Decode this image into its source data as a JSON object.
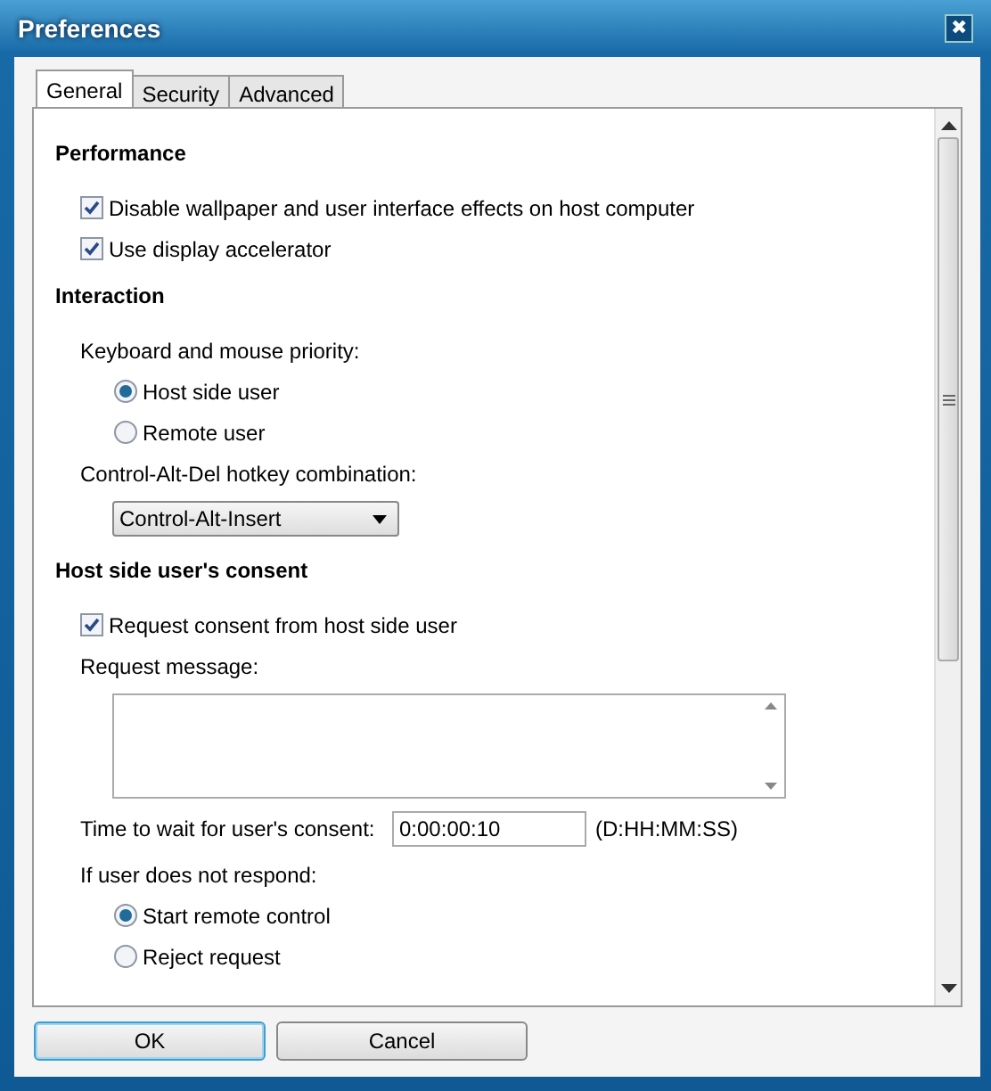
{
  "window": {
    "title": "Preferences",
    "close": "✖"
  },
  "tabs": [
    {
      "label": "General",
      "selected": true
    },
    {
      "label": "Security",
      "selected": false
    },
    {
      "label": "Advanced",
      "selected": false
    }
  ],
  "sections": [
    {
      "heading": "Performance",
      "items": [
        {
          "kind": "checkbox",
          "label": "Disable wallpaper and user interface effects on host computer",
          "checked": true
        },
        {
          "kind": "checkbox",
          "label": "Use display accelerator",
          "checked": true
        }
      ]
    },
    {
      "heading": "Interaction",
      "items": [
        {
          "kind": "label",
          "label": "Keyboard and mouse priority:"
        },
        {
          "kind": "radio",
          "label": "Host side user",
          "selected": true
        },
        {
          "kind": "radio",
          "label": "Remote user",
          "selected": false
        },
        {
          "kind": "label",
          "label": "Control-Alt-Del hotkey combination:"
        },
        {
          "kind": "select",
          "value": "Control-Alt-Insert"
        }
      ]
    },
    {
      "heading": "Host side user's consent",
      "items": [
        {
          "kind": "checkbox",
          "label": "Request consent from host side user",
          "checked": true
        },
        {
          "kind": "label",
          "label": "Request message:"
        },
        {
          "kind": "textarea"
        },
        {
          "kind": "time",
          "label": "Time to wait for user's consent:",
          "value": "0:00:00:10",
          "hint": "(D:HH:MM:SS)"
        },
        {
          "kind": "label",
          "label": "If user does not respond:"
        },
        {
          "kind": "radio",
          "label": "Start remote control",
          "selected": true
        },
        {
          "kind": "radio",
          "label": "Reject request",
          "selected": false
        }
      ]
    }
  ],
  "buttons": [
    {
      "label": "OK",
      "default": true
    },
    {
      "label": "Cancel",
      "default": false
    }
  ]
}
